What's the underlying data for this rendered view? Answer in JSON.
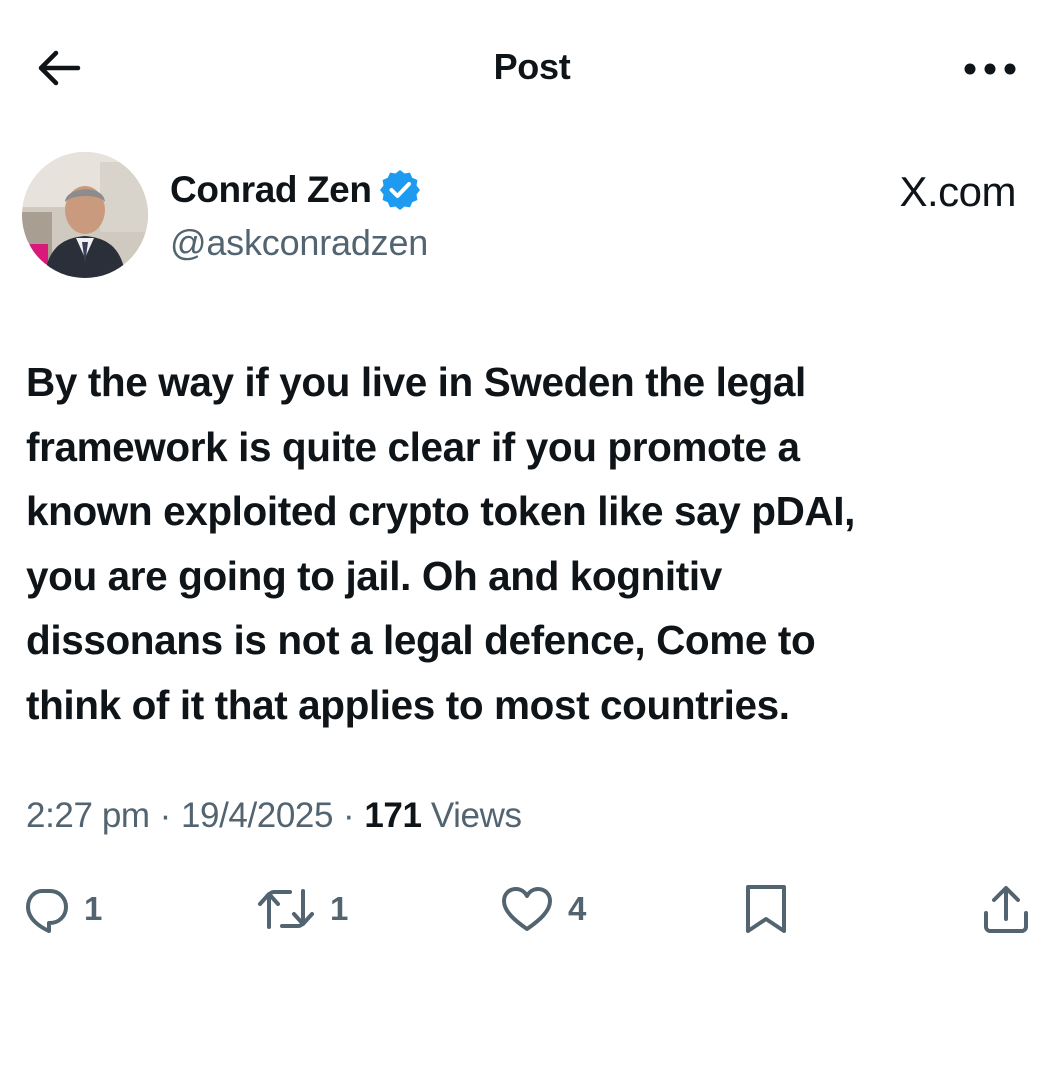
{
  "header": {
    "title": "Post",
    "back_icon": "arrow-left-icon",
    "more_icon": "more-horizontal-icon"
  },
  "author": {
    "name": "Conrad Zen",
    "handle": "@askconradzen",
    "verified": true,
    "verified_color": "#1d9bf0"
  },
  "watermark": "X.com",
  "post": {
    "lines": [
      "By the way if you live in Sweden the legal",
      "framework is quite clear if you promote a",
      "known exploited crypto token like say pDAI,",
      "you are going to jail. Oh and kognitiv",
      "dissonans is not a legal defence, Come to",
      "think of it that applies to most countries."
    ]
  },
  "meta": {
    "time": "2:27 pm",
    "date": "19/4/2025",
    "views_count": "171",
    "views_label": "Views"
  },
  "actions": {
    "replies": "1",
    "reposts": "1",
    "likes": "4"
  },
  "colors": {
    "text": "#0f1419",
    "secondary": "#536471",
    "background": "#ffffff"
  }
}
